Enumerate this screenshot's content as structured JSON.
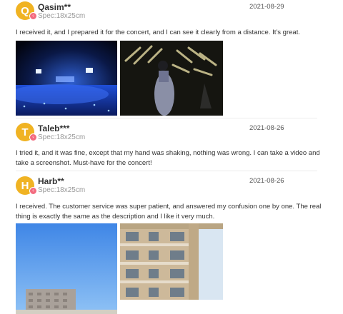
{
  "reviews": [
    {
      "avatar_letter": "Q",
      "name": "Qasim**",
      "spec": "Spec:18x25cm",
      "date": "2021-08-29",
      "text": "I received it, and I prepared it for the concert, and I can see it clearly from a distance. It’s great.",
      "photos": [
        "concert-crowd-photo",
        "stage-performer-photo"
      ]
    },
    {
      "avatar_letter": "T",
      "name": "Taleb***",
      "spec": "Spec:18x25cm",
      "date": "2021-08-26",
      "text": "I tried it, and it was fine, except that my hand was shaking, nothing was wrong. I can take a video and take a screenshot. Must-have for the concert!",
      "photos": []
    },
    {
      "avatar_letter": "H",
      "name": "Harb**",
      "spec": "Spec:18x25cm",
      "date": "2021-08-26",
      "text": "I received. The customer service was super patient, and answered my confusion one by one. The real thing is exactly the same as the description and I like it very much.",
      "photos": [
        "sky-building-photo",
        "apartment-building-photo"
      ]
    }
  ],
  "colors": {
    "avatar": "#f0b323",
    "badge": "#f36b7f"
  }
}
